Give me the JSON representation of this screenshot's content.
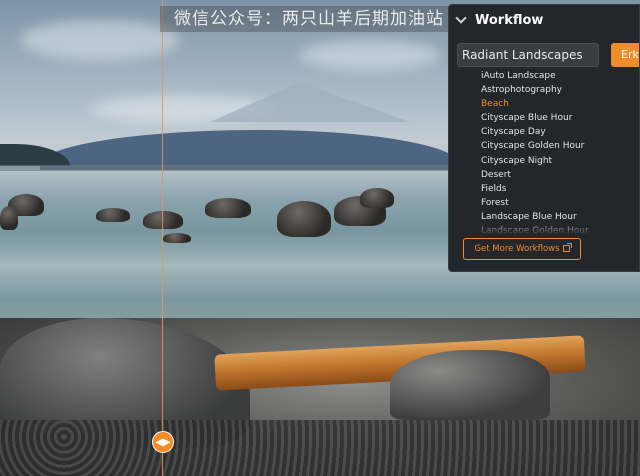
{
  "watermark": "微信公众号：两只山羊后期加油站",
  "panel": {
    "title": "Workflow",
    "selected_workflow": "Radiant Landscapes",
    "action_button": "Erkennen",
    "items": [
      {
        "label": "iAuto Landscape",
        "active": false
      },
      {
        "label": "Astrophotography",
        "active": false
      },
      {
        "label": "Beach",
        "active": true
      },
      {
        "label": "Cityscape Blue Hour",
        "active": false
      },
      {
        "label": "Cityscape Day",
        "active": false
      },
      {
        "label": "Cityscape Golden Hour",
        "active": false
      },
      {
        "label": "Cityscape Night",
        "active": false
      },
      {
        "label": "Desert",
        "active": false
      },
      {
        "label": "Fields",
        "active": false
      },
      {
        "label": "Forest",
        "active": false
      },
      {
        "label": "Landscape Blue Hour",
        "active": false
      },
      {
        "label": "Landscape Golden Hour",
        "active": false
      }
    ],
    "more_button": "Get More Workflows"
  },
  "colors": {
    "accent": "#f28c28",
    "panel_bg": "#23262b",
    "text": "#e4e6e8"
  },
  "compare_handle": {
    "icon": "split-arrows-icon",
    "glyph": "◀▶"
  }
}
